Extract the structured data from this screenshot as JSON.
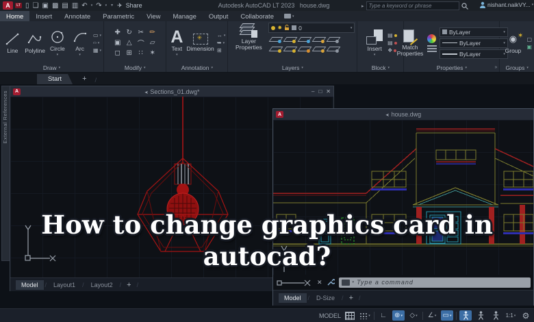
{
  "ui": {
    "caret": "▾",
    "slash": "/",
    "plus": "+"
  },
  "colors": {
    "titlebar_bg": "#1b2026",
    "ribbon_bg": "#262c36",
    "active_tab": "#3a424e",
    "logo_red": "#a31c30",
    "canvas_bg": "#0d1117",
    "window_title_bg": "#262c37",
    "drawing_red": "#b21616",
    "drawing_olive": "#7c7c2e",
    "drawing_cyan": "#2596ad",
    "drawing_blue": "#2f2fb0",
    "drawing_green": "#2fa82f",
    "layer_yellow": "#d9b430",
    "command_bar": "#9aa0a8",
    "status_active_blue": "#3c6ea5",
    "overlay_text": "#ffffff"
  },
  "titlebar": {
    "logo_a": "A",
    "logo_lt": "LT",
    "qat": [
      {
        "name": "new-file",
        "glyph": "▯"
      },
      {
        "name": "open-folder",
        "glyph": "❏"
      },
      {
        "name": "save",
        "glyph": "▣"
      },
      {
        "name": "save-as",
        "glyph": "▩"
      },
      {
        "name": "export",
        "glyph": "▤"
      },
      {
        "name": "print",
        "glyph": "▥"
      },
      {
        "name": "undo",
        "glyph": "↶"
      },
      {
        "name": "redo",
        "glyph": "↷"
      },
      {
        "name": "qat-menu",
        "glyph": "▼"
      }
    ],
    "share_icon": "✈",
    "share_label": "Share",
    "app_title": "Autodesk AutoCAD LT 2023",
    "doc_title": "house.dwg",
    "search_caret": "▸",
    "search_placeholder": "Type a keyword or phrase",
    "username": "nishant.naikVY...",
    "autodesk_access_glyph": "△"
  },
  "ribbon_tabs": {
    "tabs": [
      "Home",
      "Insert",
      "Annotate",
      "Parametric",
      "View",
      "Manage",
      "Output",
      "Collaborate"
    ],
    "active": "Home"
  },
  "ribbon": {
    "draw": {
      "label": "Draw",
      "tools": [
        "Line",
        "Polyline",
        "Circle",
        "Arc"
      ],
      "minis": [
        "▭",
        "○",
        "▦"
      ]
    },
    "modify": {
      "label": "Modify",
      "grid": [
        "✚",
        "↻",
        "✂",
        "✏",
        "▣",
        "△",
        "⌒",
        "▱",
        "◻",
        "⊞",
        "∷",
        "✶"
      ]
    },
    "annotation": {
      "label": "Annotation",
      "big_a": "A",
      "text_label": "Text",
      "dimension_label": "Dimension",
      "dim_sparkle": "✳",
      "minis": [
        "↔",
        "➥",
        "⊞"
      ]
    },
    "layers": {
      "label": "Layers",
      "big_label": "Layer Properties",
      "current_layer": "0",
      "sun_glyph": "✹"
    },
    "block": {
      "label": "Block",
      "big_label": "Insert"
    },
    "properties": {
      "label": "Properties",
      "big_label": "Match Properties",
      "rows": [
        "ByLayer",
        "ByLayer",
        "ByLayer"
      ],
      "launcher": "»"
    },
    "groups": {
      "label": "Groups",
      "big_label": "Group",
      "icon_glyph": "◉"
    }
  },
  "file_tabs": {
    "start": "Start"
  },
  "palette": {
    "title": "External References"
  },
  "window1": {
    "title": "Sections_01.dwg*",
    "pin": "➤",
    "minimize": "–",
    "maximize": "□",
    "close": "✕",
    "tabs": [
      "Model",
      "Layout1",
      "Layout2"
    ],
    "active_tab": "Model"
  },
  "window2": {
    "title": "house.dwg",
    "pin": "➤",
    "command_close": "✕",
    "command_placeholder": "Type a command",
    "tabs": [
      "Model",
      "D-Size"
    ],
    "active_tab": "Model"
  },
  "overlay": {
    "line1": "How to change graphics card in",
    "line2": "autocad?"
  },
  "statusbar": {
    "model_label": "MODEL",
    "ortho": "∟",
    "polar": "⊕",
    "isodraft": "◇",
    "osnap_tracking": "∠",
    "dynamic_input": "▭",
    "scale": "1:1",
    "gear": "⚙"
  }
}
